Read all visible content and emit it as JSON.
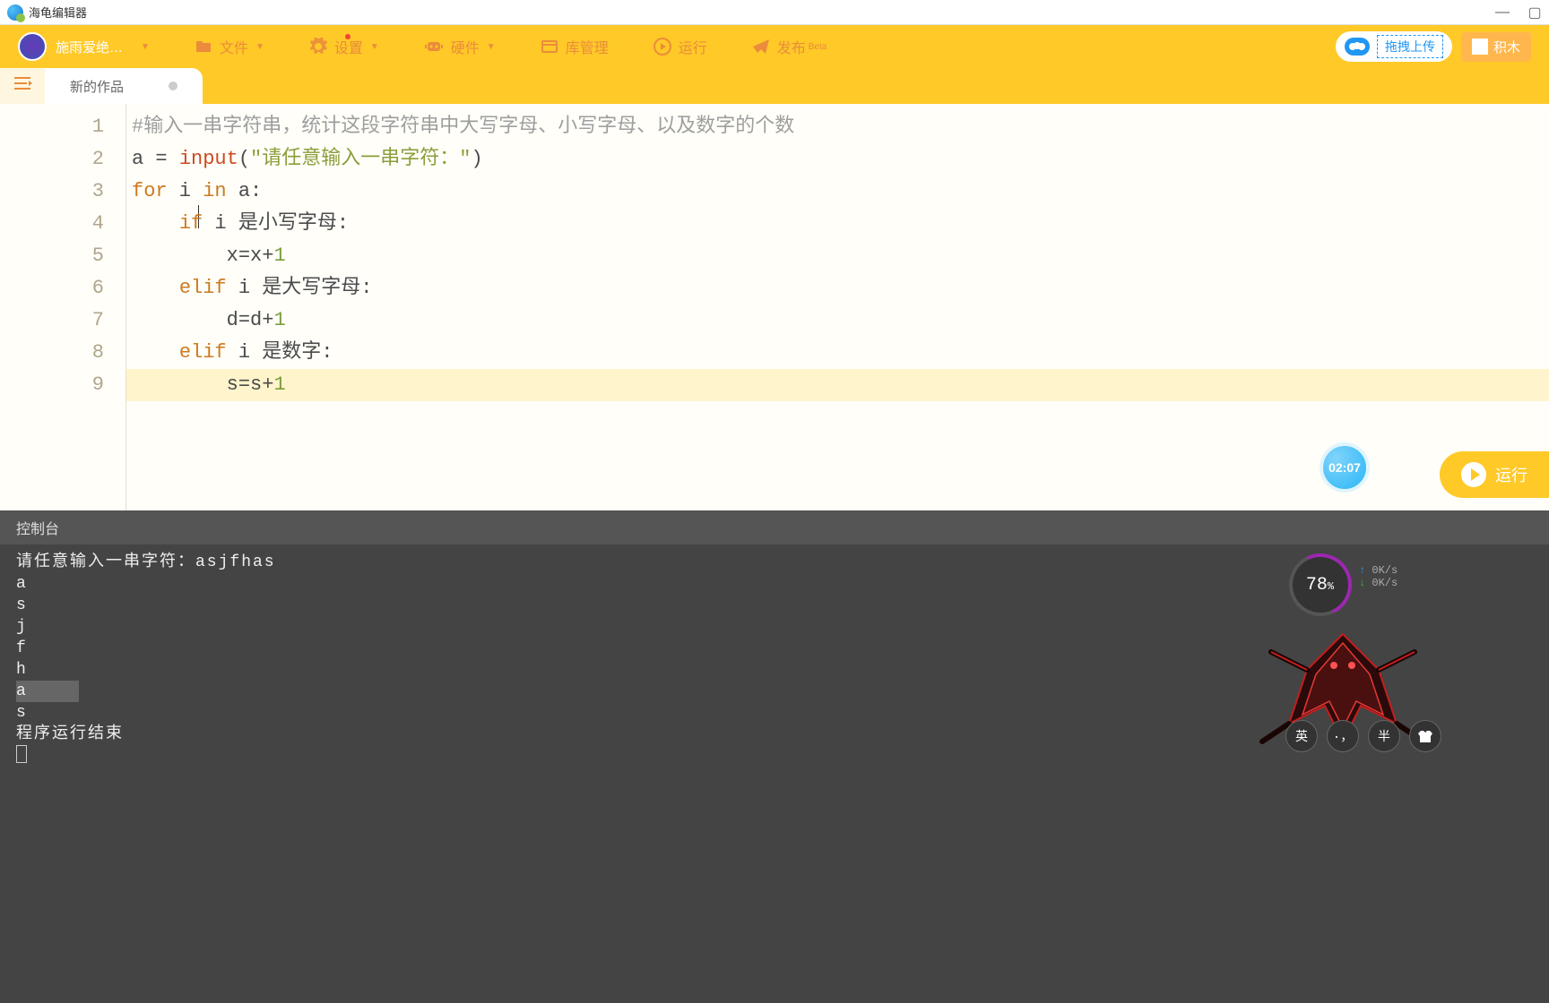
{
  "titlebar": {
    "app_name": "海龟编辑器"
  },
  "toolbar": {
    "user_name": "施雨爱绝…",
    "file": "文件",
    "settings": "设置",
    "hardware": "硬件",
    "library": "库管理",
    "run": "运行",
    "publish": "发布",
    "publish_beta": "Beta",
    "upload": "拖拽上传",
    "blocks": "积木"
  },
  "tabs": {
    "active": "新的作品"
  },
  "code": {
    "lines": [
      {
        "n": 1,
        "seg": [
          {
            "c": "comment",
            "t": "#输入一串字符串，统计这段字符串中大写字母、小写字母、以及数字的个数"
          }
        ]
      },
      {
        "n": 2,
        "seg": [
          {
            "c": "var",
            "t": "a = "
          },
          {
            "c": "func",
            "t": "input"
          },
          {
            "c": "var",
            "t": "("
          },
          {
            "c": "string",
            "t": "\"请任意输入一串字符：\""
          },
          {
            "c": "var",
            "t": ")"
          }
        ]
      },
      {
        "n": 3,
        "seg": [
          {
            "c": "keyword",
            "t": "for"
          },
          {
            "c": "var",
            "t": " i "
          },
          {
            "c": "keyword",
            "t": "in"
          },
          {
            "c": "var",
            "t": " a:"
          }
        ]
      },
      {
        "n": 4,
        "seg": [
          {
            "c": "var",
            "t": "    "
          },
          {
            "c": "keyword",
            "t": "if"
          },
          {
            "c": "var",
            "t": " i 是小写字母:"
          }
        ]
      },
      {
        "n": 5,
        "seg": [
          {
            "c": "var",
            "t": "        x=x+"
          },
          {
            "c": "num",
            "t": "1"
          }
        ]
      },
      {
        "n": 6,
        "seg": [
          {
            "c": "var",
            "t": "    "
          },
          {
            "c": "keyword",
            "t": "elif"
          },
          {
            "c": "var",
            "t": " i 是大写字母:"
          }
        ]
      },
      {
        "n": 7,
        "seg": [
          {
            "c": "var",
            "t": "        d=d+"
          },
          {
            "c": "num",
            "t": "1"
          }
        ]
      },
      {
        "n": 8,
        "seg": [
          {
            "c": "var",
            "t": "    "
          },
          {
            "c": "keyword",
            "t": "elif"
          },
          {
            "c": "var",
            "t": " i 是数字:"
          }
        ]
      },
      {
        "n": 9,
        "hl": true,
        "seg": [
          {
            "c": "var",
            "t": "        s=s+"
          },
          {
            "c": "num",
            "t": "1"
          }
        ]
      }
    ]
  },
  "timer": "02:07",
  "run_button": "运行",
  "console": {
    "title": "控制台",
    "prompt_line": "请任意输入一串字符：asjfhas",
    "output": [
      "a",
      "s",
      "j",
      "f",
      "h",
      "a",
      "s"
    ],
    "end": "程序运行结束"
  },
  "perf": {
    "cpu": "78",
    "pct": "%",
    "up": "0K/s",
    "down": "0K/s"
  },
  "ime": {
    "lang": "英",
    "punct": "·，",
    "width": "半",
    "shirt": "👕"
  }
}
